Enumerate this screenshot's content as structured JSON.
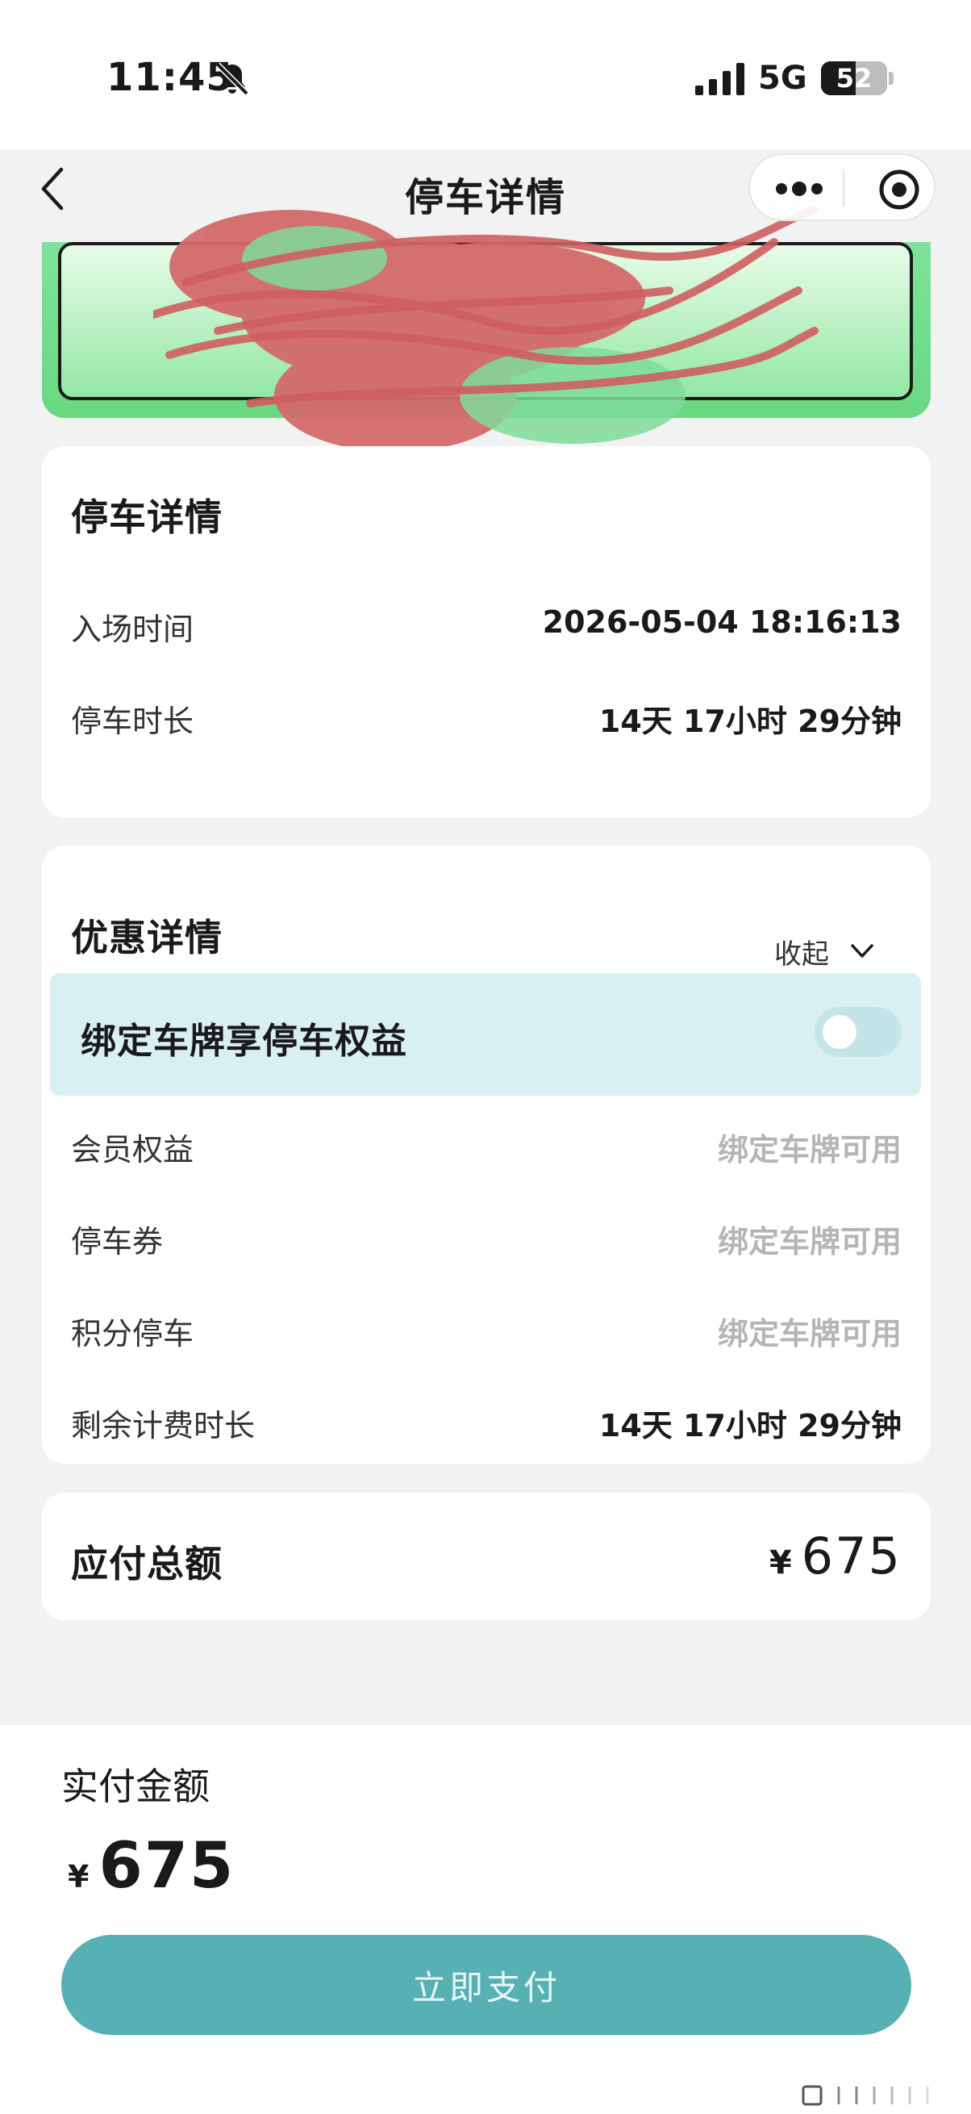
{
  "status_bar": {
    "time": "11:45",
    "network": "5G",
    "battery_label": "52",
    "battery_level_percent": 52
  },
  "nav": {
    "title": "停车详情"
  },
  "parking_details": {
    "title": "停车详情",
    "rows": [
      {
        "label": "入场时间",
        "value": "2026-05-04 18:16:13"
      },
      {
        "label": "停车时长",
        "value": "14天 17小时 29分钟"
      }
    ]
  },
  "discount_details": {
    "title": "优惠详情",
    "collapse_label": "收起",
    "bind_plate_label": "绑定车牌享停车权益",
    "bind_toggle_on": false,
    "rows": [
      {
        "label": "会员权益",
        "value": "绑定车牌可用"
      },
      {
        "label": "停车券",
        "value": "绑定车牌可用"
      },
      {
        "label": "积分停车",
        "value": "绑定车牌可用"
      },
      {
        "label": "剩余计费时长",
        "value": "14天 17小时 29分钟"
      }
    ]
  },
  "total": {
    "label": "应付总额",
    "currency": "¥",
    "amount": "675"
  },
  "payment": {
    "label": "实付金额",
    "currency": "¥",
    "amount": "675",
    "button_label": "立即支付"
  },
  "colors": {
    "primary": "#56b0b4",
    "banner_green": "#69d882",
    "bind_panel": "#d9f0f2",
    "muted_text": "#b5b5b5",
    "background": "#f2f2f2"
  }
}
